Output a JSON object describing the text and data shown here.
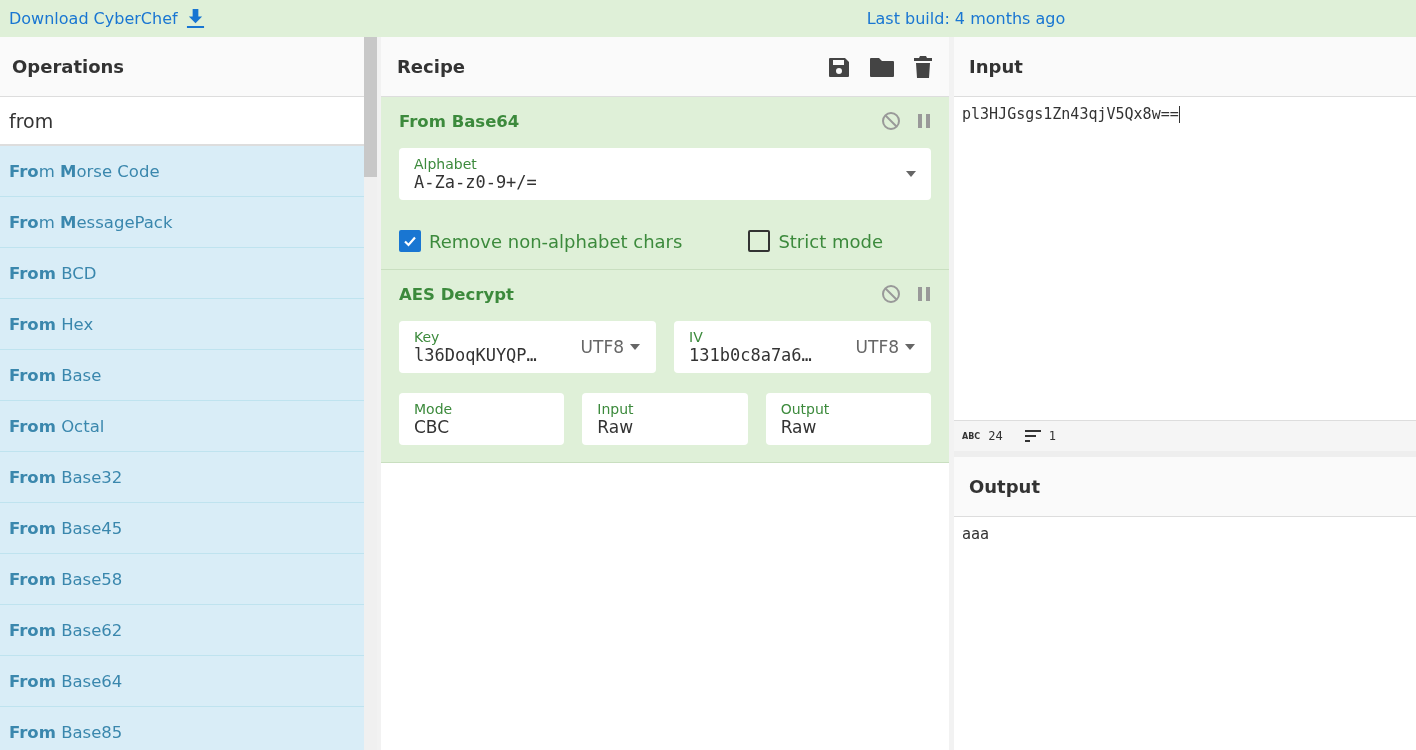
{
  "top_bar": {
    "download_link": "Download CyberChef",
    "build_info": "Last build: 4 months ago"
  },
  "operations": {
    "title": "Operations",
    "search": {
      "value": "from"
    },
    "items": [
      {
        "label": "**Fro**m **M**orse Code"
      },
      {
        "label": "**Fro**m **M**essagePack"
      },
      {
        "label": "**From** BCD"
      },
      {
        "label": "**From** Hex"
      },
      {
        "label": "**From** Base"
      },
      {
        "label": "**From** Octal"
      },
      {
        "label": "**From** Base32"
      },
      {
        "label": "**From** Base45"
      },
      {
        "label": "**From** Base58"
      },
      {
        "label": "**From** Base62"
      },
      {
        "label": "**From** Base64"
      },
      {
        "label": "**From** Base85"
      }
    ]
  },
  "recipe": {
    "title": "Recipe",
    "operations": [
      {
        "name": "From Base64",
        "disabled": false,
        "paused": false,
        "args": [
          {
            "kind": "dropdown",
            "label": "Alphabet",
            "value": "A-Za-z0-9+/="
          },
          {
            "kind": "checkbox",
            "label": "Remove non-alphabet chars",
            "checked": true
          },
          {
            "kind": "checkbox",
            "label": "Strict mode",
            "checked": false
          }
        ]
      },
      {
        "name": "AES Decrypt",
        "disabled": false,
        "paused": false,
        "args": [
          {
            "kind": "toggle",
            "label": "Key",
            "value": "l36DoqKUYQP…",
            "option": "UTF8"
          },
          {
            "kind": "toggle",
            "label": "IV",
            "value": "131b0c8a7a6…",
            "option": "UTF8"
          },
          {
            "kind": "option",
            "label": "Mode",
            "value": "CBC"
          },
          {
            "kind": "option",
            "label": "Input",
            "value": "Raw"
          },
          {
            "kind": "option",
            "label": "Output",
            "value": "Raw"
          }
        ]
      }
    ]
  },
  "input": {
    "title": "Input",
    "value": "pl3HJGsgs1Zn43qjV5Qx8w==",
    "status": {
      "length_label": "ABC",
      "length": "24",
      "lines": "1"
    }
  },
  "output": {
    "title": "Output",
    "value": "aaa"
  }
}
